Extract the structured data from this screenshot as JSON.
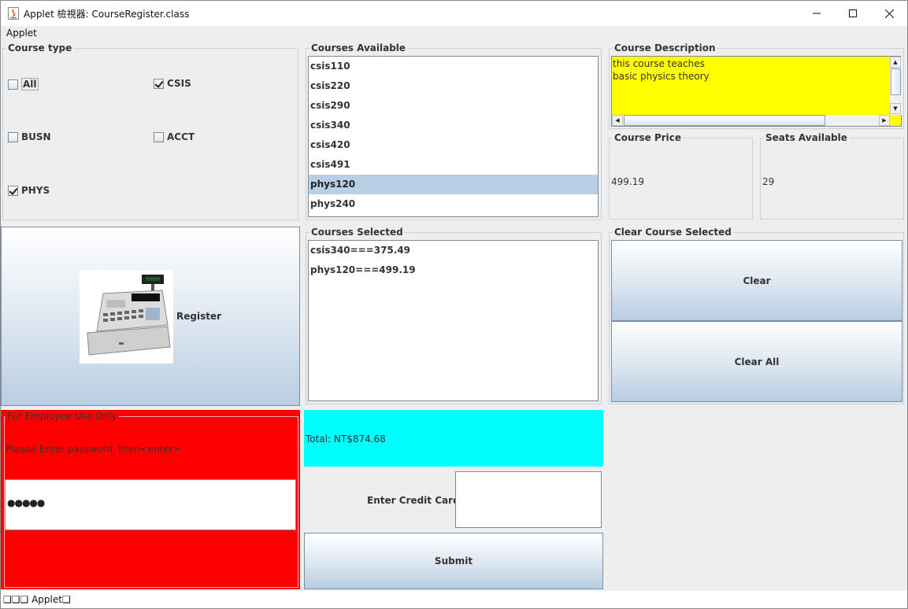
{
  "window": {
    "title": "Applet 檢視器: CourseRegister.class",
    "menu": [
      "Applet"
    ],
    "status_text": "❑❑❑ Applet❑"
  },
  "course_type": {
    "title": "Course type",
    "options": [
      {
        "label": "All",
        "checked": false
      },
      {
        "label": "CSIS",
        "checked": true
      },
      {
        "label": "BUSN",
        "checked": false
      },
      {
        "label": "ACCT",
        "checked": false
      },
      {
        "label": "PHYS",
        "checked": true
      }
    ]
  },
  "courses_available": {
    "title": "Courses Available",
    "items": [
      "csis110",
      "csis220",
      "csis290",
      "csis340",
      "csis420",
      "csis491",
      "phys120",
      "phys240"
    ],
    "selected": "phys120"
  },
  "course_description": {
    "title": "Course Description",
    "text_lines": [
      "this course teaches",
      "basic physics theory"
    ],
    "bg_color": "#ffff00"
  },
  "course_price": {
    "title": "Course Price",
    "value": "499.19"
  },
  "seats_available": {
    "title": "Seats Available",
    "value": "29"
  },
  "register": {
    "label": "Register",
    "icon": "cash-register-icon"
  },
  "courses_selected": {
    "title": "Courses Selected",
    "items": [
      "csis340===375.49",
      "phys120===499.19"
    ]
  },
  "clear_panel": {
    "title": "Clear Course Selected",
    "clear_label": "Clear",
    "clear_all_label": "Clear All"
  },
  "employee": {
    "title": "For Employee Use Only",
    "prompt": "Please Enter password, then<enter>",
    "password": "●●●●●",
    "bg_color": "#ff0000"
  },
  "total": {
    "text": "Total: NT$874.68",
    "bg_color": "#00ffff"
  },
  "credit_card": {
    "label": "Enter Credit Card#:",
    "value": ""
  },
  "submit": {
    "label": "Submit"
  },
  "colors": {
    "panel_bg": "#eeeeee",
    "selection": "#b8cfe5",
    "border": "#c6d1de"
  }
}
